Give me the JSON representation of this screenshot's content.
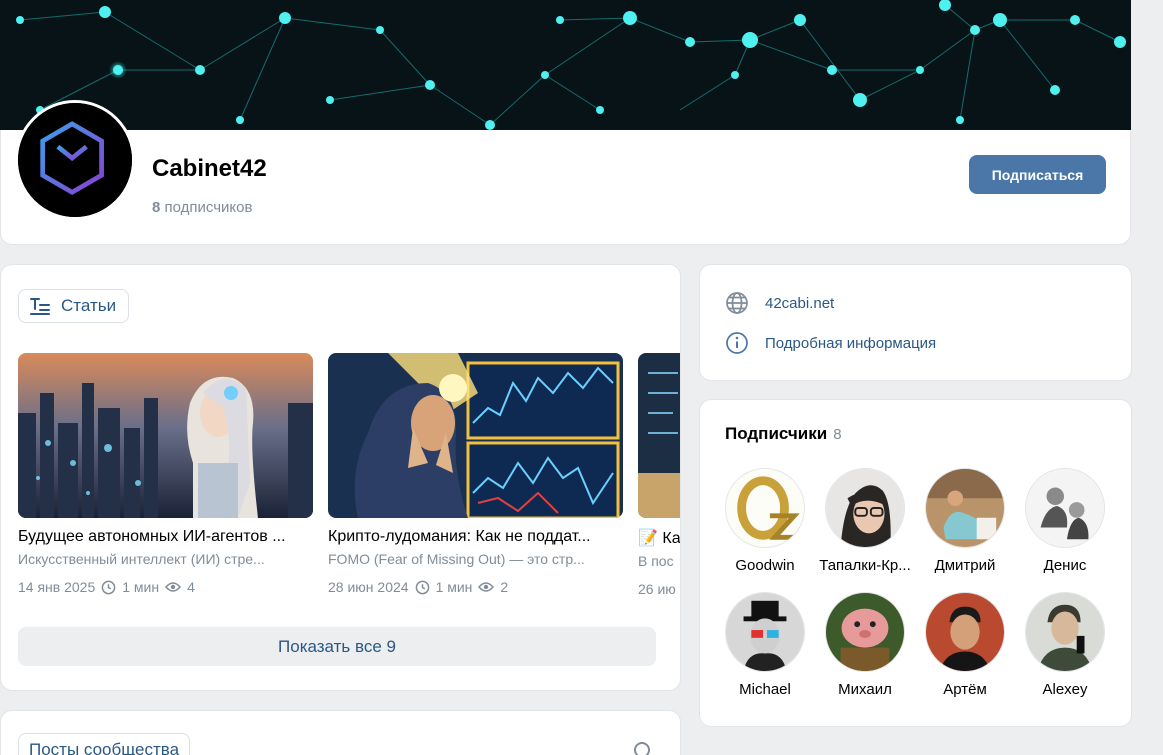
{
  "group": {
    "name": "Cabinet42",
    "subscribers_count": "8",
    "subscribers_label": "подписчиков",
    "subscribe_button": "Подписаться"
  },
  "articles": {
    "tag_label": "Статьи",
    "items": [
      {
        "title": "Будущее автономных ИИ-агентов ...",
        "desc": "Искусственный интеллект (ИИ) стре...",
        "date": "14 янв 2025",
        "read_time": "1 мин",
        "views": "4"
      },
      {
        "title": "Крипто-лудомания: Как не поддат...",
        "desc": "FOMO (Fear of Missing Out) — это стр...",
        "date": "28 июн 2024",
        "read_time": "1 мин",
        "views": "2"
      },
      {
        "title": "📝 Ка",
        "desc": "В пос",
        "date": "26 ию",
        "read_time": "",
        "views": ""
      }
    ],
    "show_all": "Показать все 9"
  },
  "posts": {
    "tag_label": "Посты сообщества"
  },
  "info": {
    "website": "42cabi.net",
    "details": "Подробная информация"
  },
  "followers": {
    "title": "Подписчики",
    "count": "8",
    "items": [
      {
        "name": "Goodwin"
      },
      {
        "name": "Тапалки-Кр..."
      },
      {
        "name": "Дмитрий"
      },
      {
        "name": "Денис"
      },
      {
        "name": "Michael"
      },
      {
        "name": "Михаил"
      },
      {
        "name": "Артём"
      },
      {
        "name": "Alexey"
      }
    ]
  },
  "colors": {
    "accent": "#4a76a8",
    "link": "#2a5885",
    "muted": "#818c99",
    "background": "#edeef0"
  }
}
